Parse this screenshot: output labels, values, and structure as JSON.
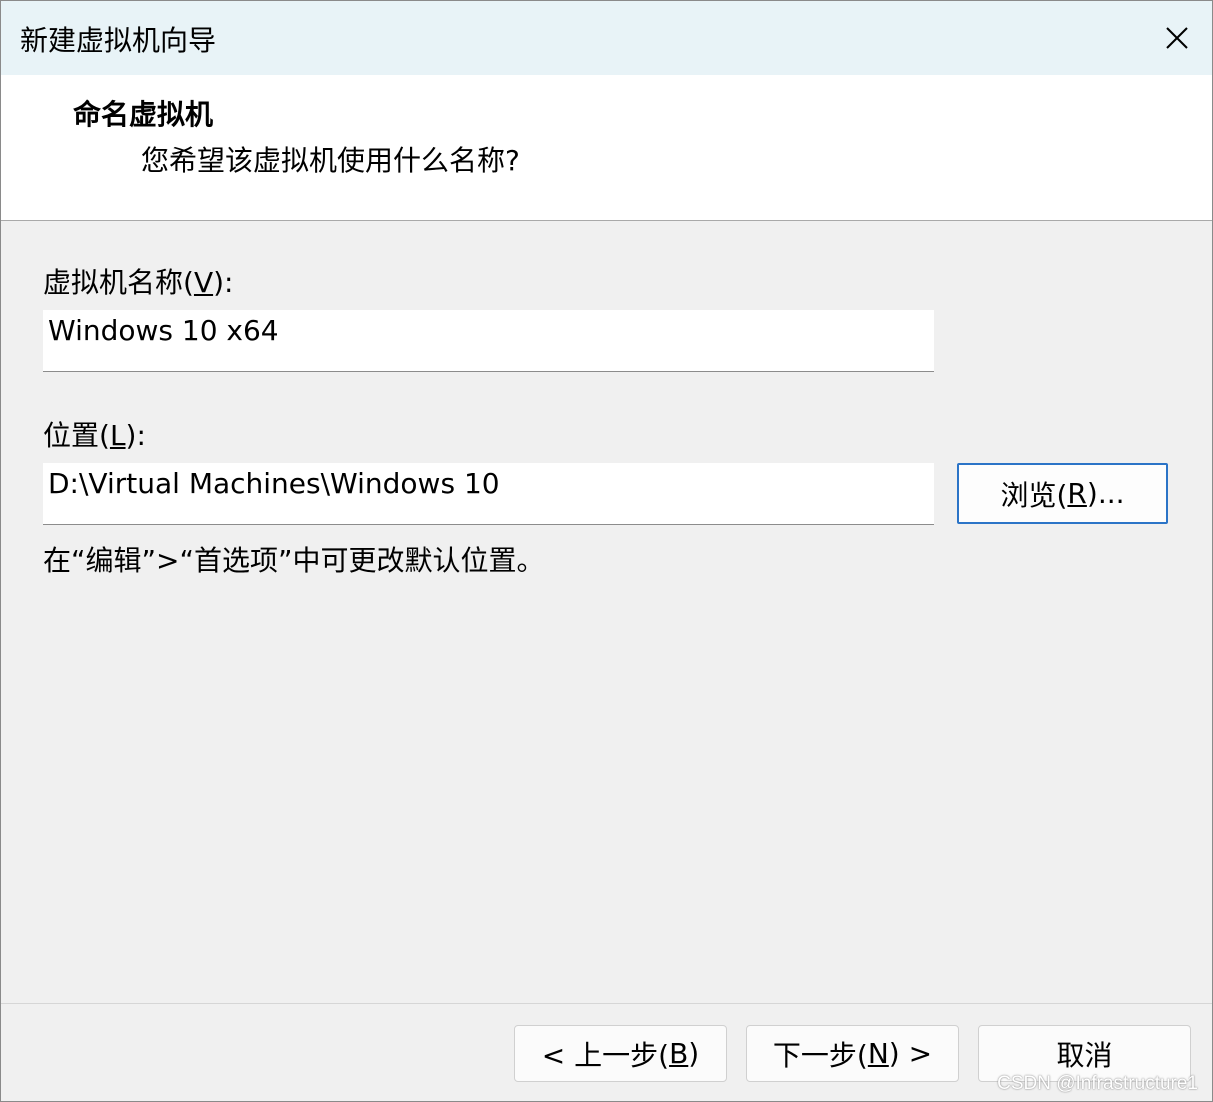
{
  "window": {
    "title": "新建虚拟机向导",
    "close_icon": "close-icon"
  },
  "header": {
    "title": "命名虚拟机",
    "subtitle": "您希望该虚拟机使用什么名称?"
  },
  "name_field": {
    "label_prefix": "虚拟机名称(",
    "label_accel": "V",
    "label_suffix": "):",
    "value": "Windows 10 x64"
  },
  "location_field": {
    "label_prefix": "位置(",
    "label_accel": "L",
    "label_suffix": "):",
    "value": "D:\\Virtual Machines\\Windows 10"
  },
  "browse_button": {
    "prefix": "浏览(",
    "accel": "R",
    "suffix": ")..."
  },
  "hint": "在“编辑”>“首选项”中可更改默认位置。",
  "buttons": {
    "back": {
      "prefix": "< 上一步(",
      "accel": "B",
      "suffix": ")"
    },
    "next": {
      "prefix": "下一步(",
      "accel": "N",
      "suffix": ") >"
    },
    "cancel": "取消"
  },
  "watermark": "CSDN @Infrastructure1"
}
